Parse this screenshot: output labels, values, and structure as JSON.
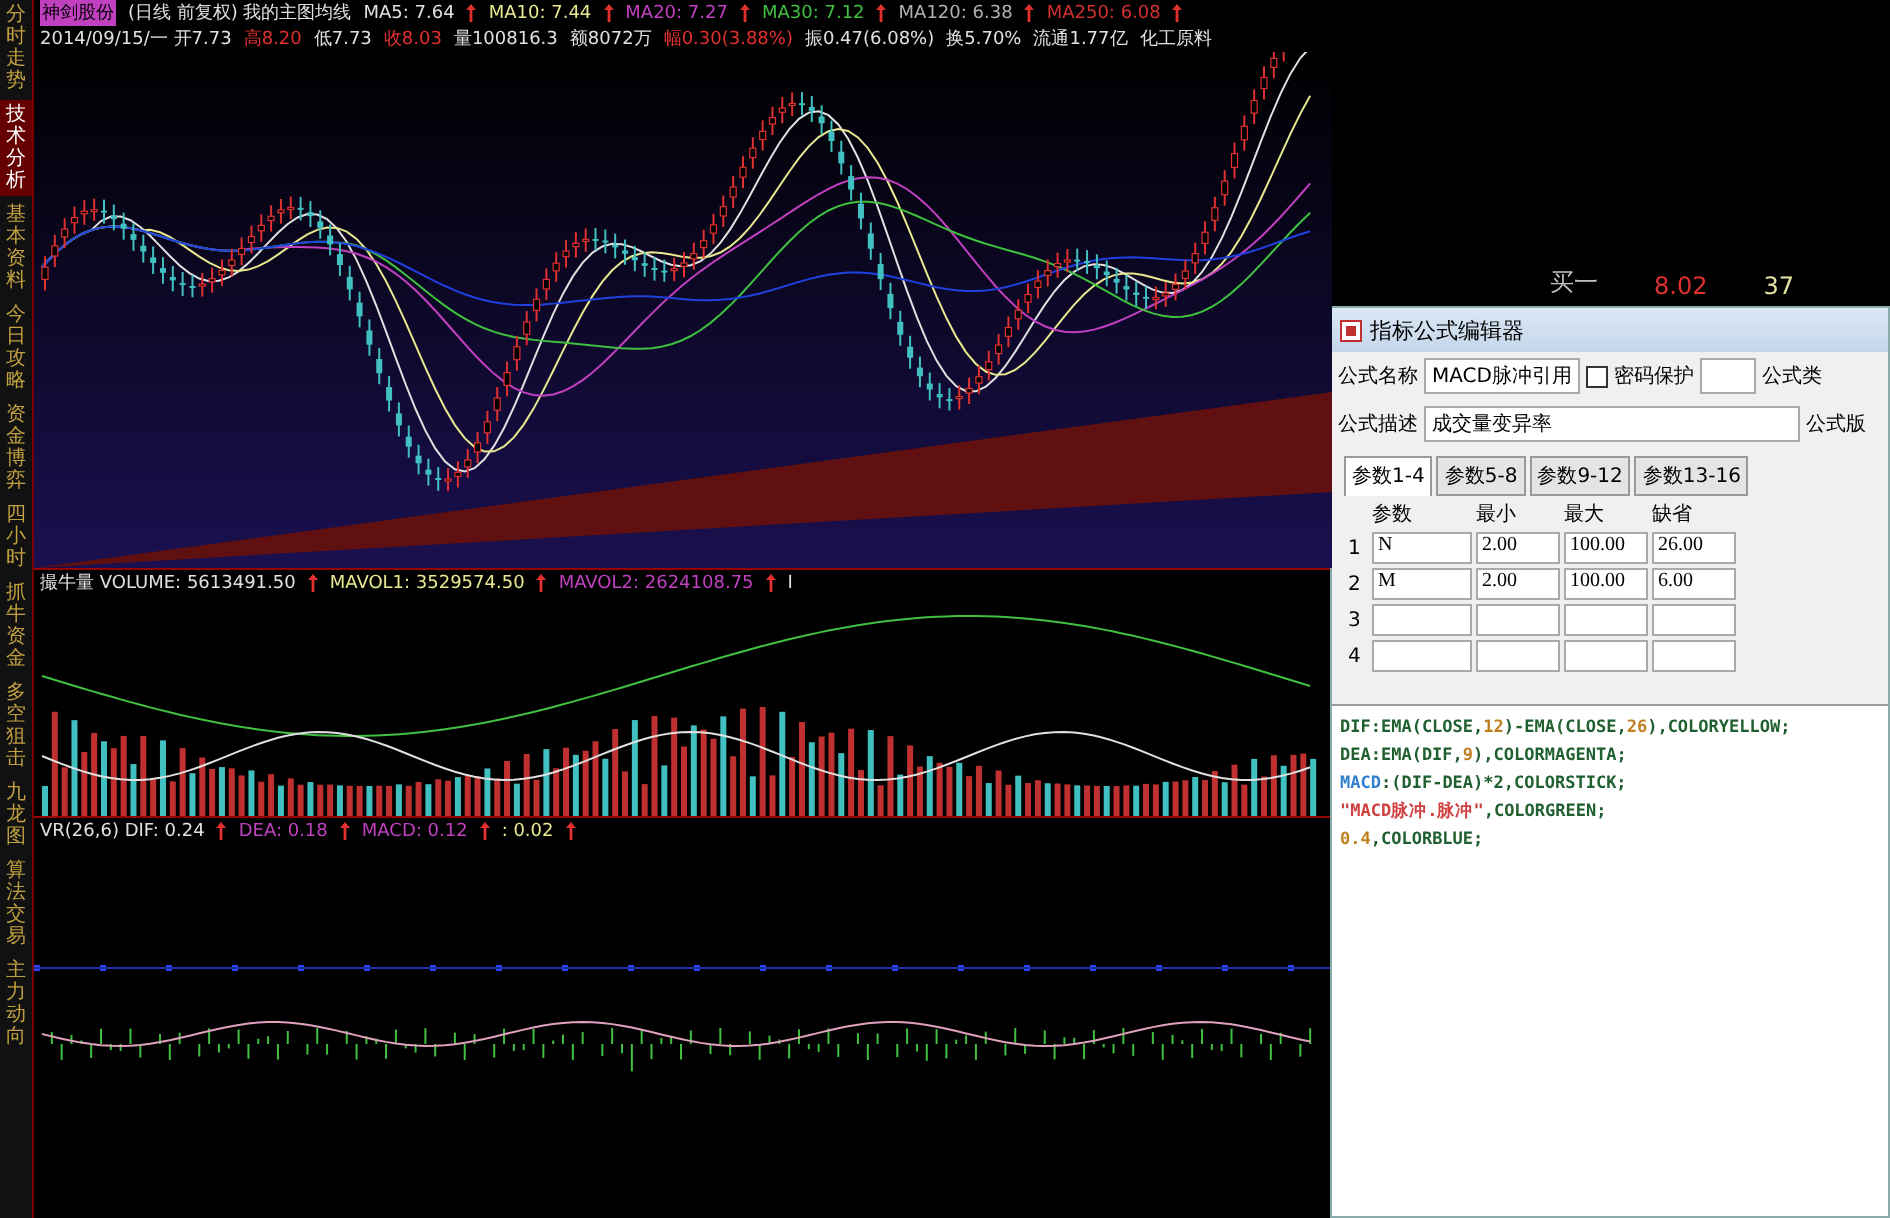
{
  "side_tabs": [
    {
      "label": "分时走势",
      "selected": false
    },
    {
      "label": "技术分析",
      "selected": true
    },
    {
      "label": "基本资料",
      "selected": false
    },
    {
      "label": "今日攻略",
      "selected": false
    },
    {
      "label": "资金博弈",
      "selected": false
    },
    {
      "label": "四小时",
      "selected": false
    },
    {
      "label": "抓牛资金",
      "selected": false
    },
    {
      "label": "多空狙击",
      "selected": false
    },
    {
      "label": "九龙图",
      "selected": false
    },
    {
      "label": "算法交易",
      "selected": false
    },
    {
      "label": "主力动向",
      "selected": false
    }
  ],
  "main_chart": {
    "title": "神剑股份",
    "subtitle": "(日线 前复权) 我的主图均线",
    "ma": [
      {
        "text": "MA5: 7.64",
        "color": "#e0e0e0"
      },
      {
        "text": "MA10: 7.44",
        "color": "#e8e890"
      },
      {
        "text": "MA20: 7.27",
        "color": "#c040c0"
      },
      {
        "text": "MA30: 7.12",
        "color": "#40c040"
      },
      {
        "text": "MA120: 6.38",
        "color": "#b0b0b0"
      },
      {
        "text": "MA250: 6.08",
        "color": "#d03030"
      }
    ],
    "quote": [
      {
        "text": "2014/09/15/一 开7.73",
        "color": "#e0e0e0"
      },
      {
        "text": "高8.20",
        "color": "#e03030"
      },
      {
        "text": "低7.73",
        "color": "#e0e0e0"
      },
      {
        "text": "收8.03",
        "color": "#e03030"
      },
      {
        "text": "量100816.3",
        "color": "#e0e0e0"
      },
      {
        "text": "额8072万",
        "color": "#e0e0e0"
      },
      {
        "text": "幅0.30(3.88%)",
        "color": "#e03030"
      },
      {
        "text": "振0.47(6.08%)",
        "color": "#e0e0e0"
      },
      {
        "text": "换5.70%",
        "color": "#e0e0e0"
      },
      {
        "text": "流通1.77亿",
        "color": "#e0e0e0"
      },
      {
        "text": "化工原料",
        "color": "#e0e0e0"
      }
    ]
  },
  "volume_panel": {
    "legend": [
      {
        "text": "撮牛量 VOLUME: 5613491.50",
        "color": "#e0e0e0"
      },
      {
        "text": "MAVOL1: 3529574.50",
        "color": "#e8e890"
      },
      {
        "text": "MAVOL2: 2624108.75",
        "color": "#c040c0"
      }
    ],
    "tail": "I"
  },
  "macd_panel": {
    "legend": [
      {
        "text": "VR(26,6) DIF: 0.24",
        "color": "#e0e0e0"
      },
      {
        "text": "DEA: 0.18",
        "color": "#c040c0"
      },
      {
        "text": "MACD: 0.12",
        "color": "#c040c0"
      },
      {
        "text": ": 0.02",
        "color": "#e8e890"
      }
    ]
  },
  "order_book": {
    "label": "买一",
    "price": "8.02",
    "volume": "37"
  },
  "editor": {
    "title": "指标公式编辑器",
    "name_label": "公式名称",
    "name_value": "MACD脉冲引用",
    "password": {
      "label": "密码保护",
      "checked": false
    },
    "type_label": "公式类",
    "desc_label": "公式描述",
    "desc_value": "成交量变异率",
    "version_label": "公式版",
    "tabs": [
      {
        "label": "参数1-4",
        "selected": true
      },
      {
        "label": "参数5-8",
        "selected": false
      },
      {
        "label": "参数9-12",
        "selected": false
      },
      {
        "label": "参数13-16",
        "selected": false
      }
    ],
    "columns": [
      "参数",
      "最小",
      "最大",
      "缺省"
    ],
    "rows": [
      {
        "index": "1",
        "cells": [
          "N",
          "2.00",
          "100.00",
          "26.00"
        ]
      },
      {
        "index": "2",
        "cells": [
          "M",
          "2.00",
          "100.00",
          "6.00"
        ]
      },
      {
        "index": "3",
        "cells": [
          "",
          "",
          "",
          ""
        ]
      },
      {
        "index": "4",
        "cells": [
          "",
          "",
          "",
          ""
        ]
      }
    ],
    "code": [
      [
        {
          "text": "DIF:EMA(CLOSE,",
          "color": "#206030"
        },
        {
          "text": "12",
          "color": "#c08020"
        },
        {
          "text": ")-EMA(CLOSE,",
          "color": "#206030"
        },
        {
          "text": "26",
          "color": "#c08020"
        },
        {
          "text": "),COLORYELLOW;",
          "color": "#206030"
        }
      ],
      [
        {
          "text": "DEA:EMA(DIF,",
          "color": "#206030"
        },
        {
          "text": "9",
          "color": "#c08020"
        },
        {
          "text": "),COLORMAGENTA;",
          "color": "#206030"
        }
      ],
      [
        {
          "text": "MACD",
          "color": "#3080d0"
        },
        {
          "text": ":(DIF-DEA)*2,COLORSTICK;",
          "color": "#206030"
        }
      ],
      [
        {
          "text": "\"MACD脉冲.脉冲\"",
          "color": "#d04040"
        },
        {
          "text": ",COLORGREEN;",
          "color": "#206030"
        }
      ],
      [
        {
          "text": "0.4",
          "color": "#c08020"
        },
        {
          "text": ",COLORBLUE;",
          "color": "#206030"
        }
      ]
    ]
  }
}
